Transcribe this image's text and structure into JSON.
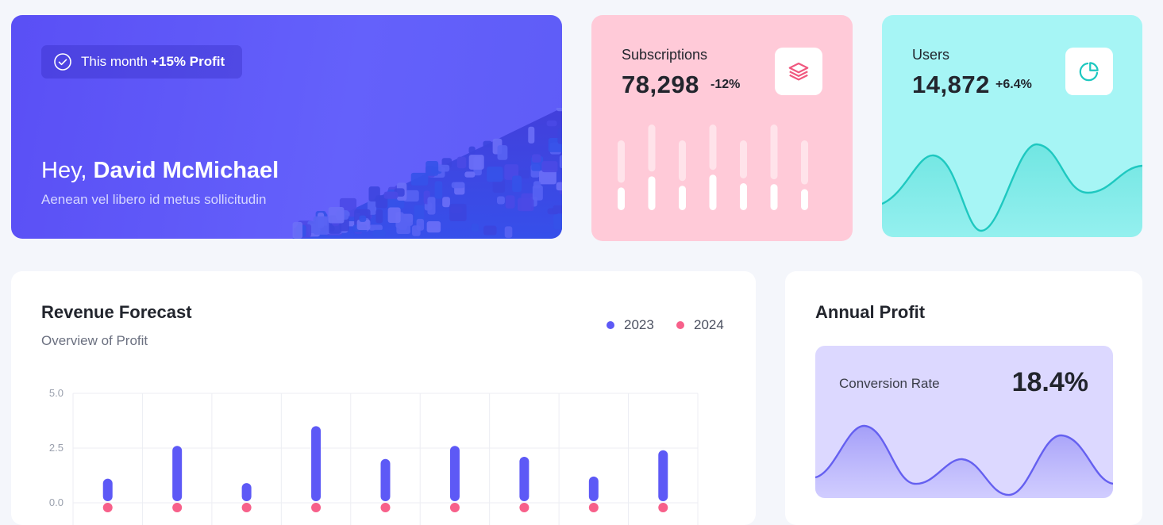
{
  "welcome": {
    "pill_prefix": "This month",
    "pill_highlight": "+15% Profit",
    "greeting": "Hey,",
    "name": "David McMichael",
    "subtitle": "Aenean vel libero id metus sollicitudin"
  },
  "subscriptions": {
    "label": "Subscriptions",
    "value": "78,298",
    "change": "-12%",
    "icon": "layers-icon",
    "accent": "#f0587f",
    "bars": [
      0.45,
      0.58,
      0.47,
      0.6,
      0.5,
      0.49,
      0.43
    ]
  },
  "users": {
    "label": "Users",
    "value": "14,872",
    "change": "+6.4%",
    "icon": "pie-chart-icon",
    "accent": "#1ec8c0"
  },
  "revenue": {
    "title": "Revenue Forecast",
    "subtitle": "Overview of Profit",
    "legend_2023": "2023",
    "legend_2024": "2024",
    "color_2023": "#5d59f6",
    "color_2024": "#f7608a"
  },
  "annual": {
    "title": "Annual Profit",
    "conversion_label": "Conversion Rate",
    "conversion_value": "18.4%",
    "accent": "#6560f0"
  },
  "chart_data": {
    "type": "bar",
    "title": "Revenue Forecast",
    "ylim": [
      0,
      5
    ],
    "yticks": [
      "5.0",
      "2.5",
      "0.0"
    ],
    "grid": true,
    "legend_position": "top-right",
    "series": [
      {
        "name": "2023",
        "values": [
          1.1,
          2.6,
          0.9,
          3.5,
          2.0,
          2.6,
          2.1,
          1.2,
          2.4
        ]
      },
      {
        "name": "2024",
        "values": [
          0.0,
          0.0,
          0.0,
          0.0,
          0.0,
          0.0,
          0.0,
          0.0,
          0.0
        ]
      }
    ]
  }
}
